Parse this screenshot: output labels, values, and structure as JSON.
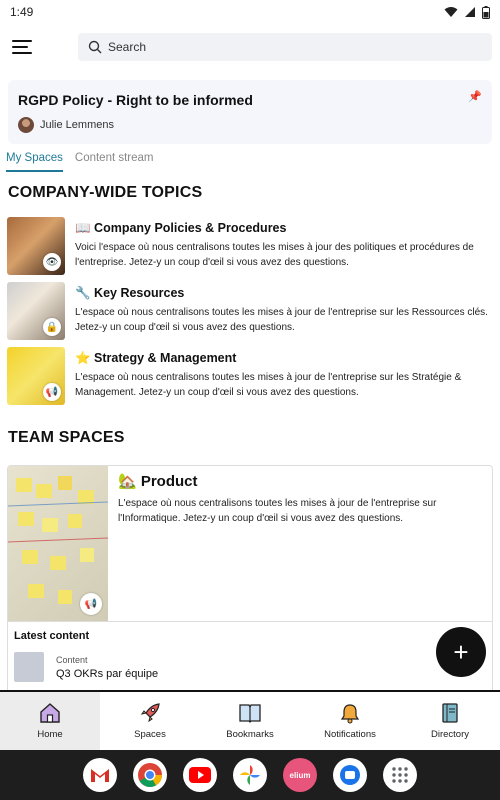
{
  "status": {
    "time": "1:49"
  },
  "search": {
    "placeholder": "Search"
  },
  "pinned": {
    "title": "RGPD Policy - Right to be informed",
    "author": "Julie Lemmens"
  },
  "tabs": [
    {
      "label": "My Spaces"
    },
    {
      "label": "Content stream"
    }
  ],
  "company_section": {
    "title": "COMPANY-WIDE TOPICS"
  },
  "topics": [
    {
      "title": "📖 Company Policies & Procedures",
      "desc": "Voici l'espace où nous centralisons toutes les mises à jour des politiques et procédures de l'entreprise. Jetez-y un coup d'œil si vous avez des questions.",
      "badge": "eye-icon"
    },
    {
      "title": "🔧 Key Resources",
      "desc": "L'espace où nous centralisons toutes les mises à jour de l'entreprise sur les Ressources clés. Jetez-y un coup d'œil si vous avez des questions.",
      "badge": "lock-icon"
    },
    {
      "title": "⭐ Strategy & Management",
      "desc": "L'espace où nous centralisons toutes les mises à jour de l'entreprise sur les Stratégie & Management. Jetez-y un coup d'œil si vous avez des questions.",
      "badge": "megaphone-icon"
    }
  ],
  "team_section": {
    "title": "TEAM SPACES"
  },
  "product": {
    "title": "🏡 Product",
    "desc": "L'espace où nous centralisons toutes les mises à jour de l'entreprise sur l'Informatique. Jetez-y un coup d'œil si vous avez des questions.",
    "latest_title": "Latest content",
    "latest_kind": "Content",
    "latest_name": "Q3 OKRs par équipe"
  },
  "nav": [
    {
      "label": "Home",
      "icon": "home-icon"
    },
    {
      "label": "Spaces",
      "icon": "rocket-icon"
    },
    {
      "label": "Bookmarks",
      "icon": "book-icon"
    },
    {
      "label": "Notifications",
      "icon": "bell-icon"
    },
    {
      "label": "Directory",
      "icon": "notebook-icon"
    }
  ],
  "dock": {
    "elium_label": "elium"
  }
}
